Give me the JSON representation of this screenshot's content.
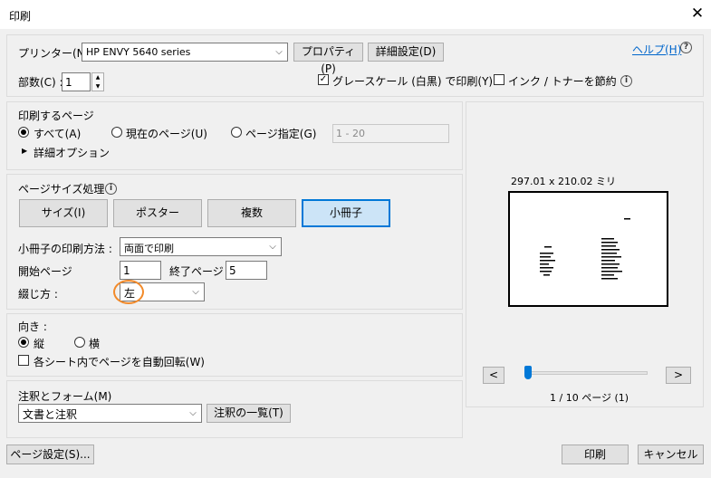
{
  "window": {
    "title": "印刷",
    "close": "✕"
  },
  "printer": {
    "label": "プリンター(N) :",
    "selected": "HP ENVY 5640 series",
    "properties_label": "プロパティ(P)",
    "advanced_label": "詳細設定(D)",
    "help_label": "ヘルプ(H)",
    "help_icon": "?"
  },
  "copies": {
    "label": "部数(C) :",
    "value": "1",
    "grayscale_label": "グレースケール (白黒) で印刷(Y)",
    "grayscale_checked": true,
    "save_ink_label": "インク / トナーを節約",
    "save_ink_checked": false,
    "info_icon": "i"
  },
  "pages_to_print": {
    "heading": "印刷するページ",
    "options": [
      "すべて(A)",
      "現在のページ(U)",
      "ページ指定(G)"
    ],
    "selected_index": 0,
    "range_value": "1 - 20",
    "more_options": "詳細オプション"
  },
  "page_sizing": {
    "heading": "ページサイズ処理",
    "info_icon": "i",
    "tabs": [
      "サイズ(I)",
      "ポスター",
      "複数",
      "小冊子"
    ],
    "selected_tab": 3,
    "booklet_label": "小冊子の印刷方法 :",
    "booklet_value": "両面で印刷",
    "start_label": "開始ページ",
    "start_value": "1",
    "end_label": "終了ページ",
    "end_value": "5",
    "binding_label": "綴じ方 :",
    "binding_value": "左"
  },
  "orientation": {
    "heading": "向き :",
    "options": [
      "縦",
      "横"
    ],
    "selected_index": 0,
    "autorotate_label": "各シート内でページを自動回転(W)",
    "autorotate_checked": false
  },
  "comments": {
    "heading": "注釈とフォーム(M)",
    "value": "文書と注釈",
    "summary_label": "注釈の一覧(T)"
  },
  "preview": {
    "size_text": "297.01 x 210.02 ミリ",
    "prev_label": "<",
    "next_label": ">",
    "page_text": "1 / 10 ページ (1)",
    "slider_fraction": 0.0
  },
  "footer": {
    "page_setup_label": "ページ設定(S)...",
    "print_label": "印刷",
    "cancel_label": "キャンセル"
  },
  "colors": {
    "accent": "#0078d7",
    "highlight_circle": "#f28a2a",
    "link": "#0066cc"
  }
}
